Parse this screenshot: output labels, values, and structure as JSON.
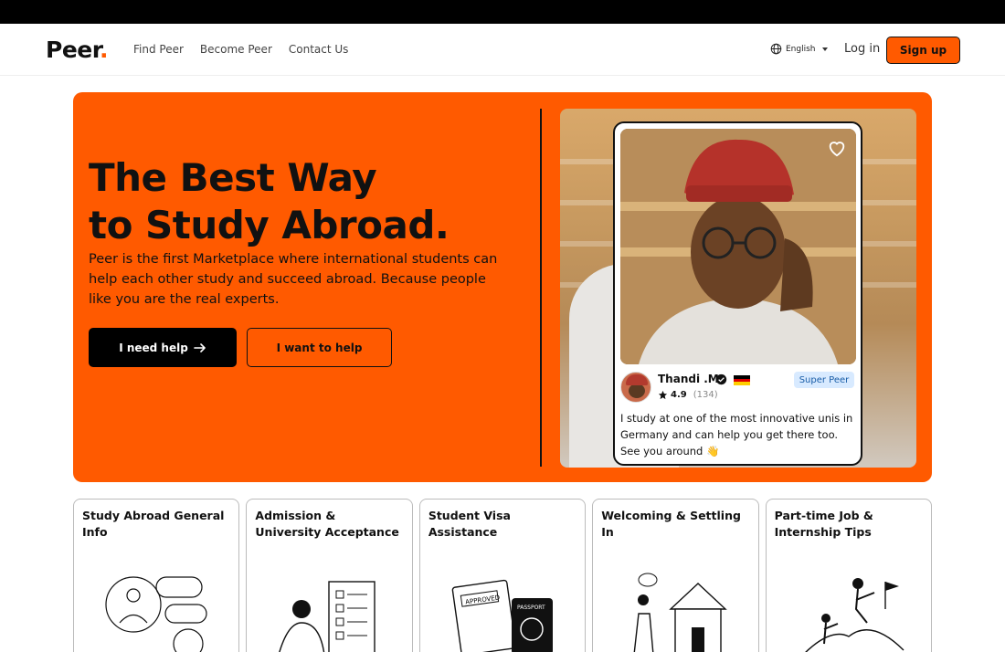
{
  "nav": {
    "logo": "Peer",
    "logo_dot": ".",
    "links": [
      "Find Peer",
      "Become Peer",
      "Contact Us"
    ],
    "language": "English",
    "language_icon": "globe-icon",
    "login": "Log in",
    "signup": "Sign up"
  },
  "hero": {
    "title_line1": "The Best Way",
    "title_line2": "to Study Abroad.",
    "description": "Peer is the first Marketplace where international students can help each other study and succeed abroad. Because people like you are the real experts.",
    "primary_cta": "I need help",
    "primary_icon": "arrow-right-icon",
    "secondary_cta": "I want to help"
  },
  "profile_card": {
    "name": "Thandi .M",
    "badge": "Super Peer",
    "rating": "4.9",
    "reviews": "(134)",
    "quote": "I study at one of the most innovative unis in Germany and can help you get there too. See you around 👋",
    "verified_icon": "verified-badge-icon",
    "flag": "germany-flag-icon",
    "favorite_icon": "heart-icon"
  },
  "categories": [
    {
      "title": "Study Abroad General Info",
      "icon": "chat-people-illustration"
    },
    {
      "title": "Admission & University Acceptance",
      "icon": "checklist-illustration"
    },
    {
      "title": "Student Visa Assistance",
      "icon": "visa-passport-illustration"
    },
    {
      "title": "Welcoming & Settling In",
      "icon": "house-illustration"
    },
    {
      "title": "Part-time Job & Internship Tips",
      "icon": "climbing-goal-illustration"
    }
  ],
  "colors": {
    "brand": "#ff5a00",
    "dark": "#111111",
    "badge_bg": "#d8eaff"
  }
}
